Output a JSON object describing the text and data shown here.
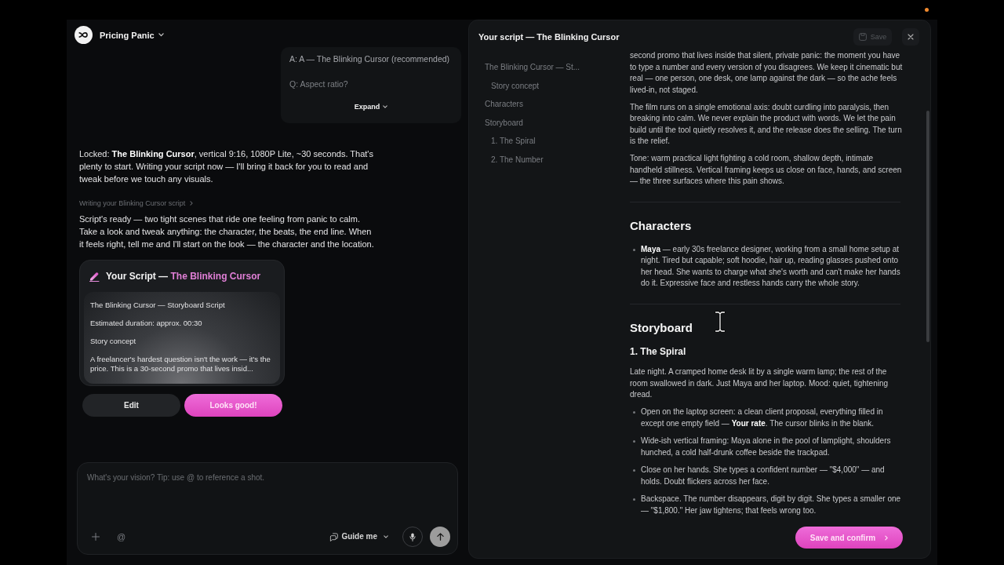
{
  "project": {
    "name": "Pricing Panic"
  },
  "chat": {
    "qa_summary": {
      "lines": [
        {
          "kind": "answer",
          "text": "A: A — The Blinking Cursor (recommended)"
        },
        {
          "kind": "question",
          "text": "Q: Aspect ratio?"
        }
      ],
      "expand_label": "Expand"
    },
    "messages": [
      {
        "kind": "text",
        "text": "Locked: **The Blinking Cursor**, vertical 9:16, 1080P Lite, ~30 seconds. That's plenty to start. Writing your script now — I'll bring it back for you to read and tweak before we touch any visuals."
      },
      {
        "kind": "status",
        "text": "Writing your Blinking Cursor script"
      },
      {
        "kind": "text",
        "text": "Script's ready — two tight scenes that ride one feeling from panic to calm. Take a look and tweak anything: the character, the beats, the end line. When it feels right, tell me and I'll start on the look — the character and the location."
      },
      {
        "kind": "script_card",
        "title": "Your Script —",
        "title_accent": "The Blinking Cursor",
        "preview": [
          "The Blinking Cursor — Storyboard Script",
          "Estimated duration: approx. 00:30",
          "Story concept",
          "A freelancer's hardest question isn't the work — it's the price. This is a 30-second promo that lives insid..."
        ],
        "actions": [
          {
            "label": "Edit",
            "primary": false
          },
          {
            "label": "Looks good!",
            "primary": true
          }
        ]
      }
    ]
  },
  "composer": {
    "placeholder": "What's your vision? Tip: use @ to reference a shot.",
    "mention_label": "@",
    "mode_label": "Guide me"
  },
  "script_panel": {
    "title": "Your script — The Blinking Cursor",
    "save": {
      "label": "Save",
      "disabled": true
    },
    "toc": [
      {
        "label": "The Blinking Cursor — St...",
        "children": [
          {
            "label": "Story concept"
          }
        ]
      },
      {
        "label": "Characters"
      },
      {
        "label": "Storyboard",
        "children": [
          {
            "label": "1. The Spiral"
          },
          {
            "label": "2. The Number"
          }
        ]
      }
    ],
    "sections": [
      {
        "kind": "paragraph",
        "text": "second promo that lives inside that silent, private panic: the moment you have to type a number and every version of you disagrees. We keep it cinematic but real — one person, one desk, one lamp against the dark — so the ache feels lived-in, not staged."
      },
      {
        "kind": "paragraph",
        "text": "The film runs on a single emotional axis: doubt curdling into paralysis, then breaking into calm. We never explain the product with words. We let the pain build until the tool quietly resolves it, and the release does the selling. The turn is the relief."
      },
      {
        "kind": "paragraph",
        "text": "Tone: warm practical light fighting a cold room, shallow depth, intimate handheld stillness. Vertical framing keeps us close on face, hands, and screen — the three surfaces where this pain shows."
      },
      {
        "kind": "divider"
      },
      {
        "kind": "heading",
        "text": "Characters"
      },
      {
        "kind": "bullets",
        "items": [
          "**Maya** — early 30s freelance designer, working from a small home setup at night. Tired but capable; soft hoodie, hair up, reading glasses pushed onto her head. She wants to charge what she's worth and can't make her hands do it. Expressive face and restless hands carry the whole story."
        ]
      },
      {
        "kind": "divider"
      },
      {
        "kind": "heading",
        "text": "Storyboard"
      },
      {
        "kind": "subheading",
        "text": "1. The Spiral"
      },
      {
        "kind": "paragraph",
        "text": "Late night. A cramped home desk lit by a single warm lamp; the rest of the room swallowed in dark. Just Maya and her laptop. Mood: quiet, tightening dread."
      },
      {
        "kind": "bullets",
        "items": [
          "Open on the laptop screen: a clean client proposal, everything filled in except one empty field — **Your rate**. The cursor blinks in the blank.",
          "Wide-ish vertical framing: Maya alone in the pool of lamplight, shoulders hunched, a cold half-drunk coffee beside the trackpad.",
          "Close on her hands. She types a confident number — \"$4,000\" — and holds. Doubt flickers across her face.",
          "Backspace. The number disappears, digit by digit. She types a smaller one — \"$1,800.\" Her jaw tightens; that feels wrong too."
        ]
      }
    ],
    "confirm_label": "Save and confirm"
  }
}
